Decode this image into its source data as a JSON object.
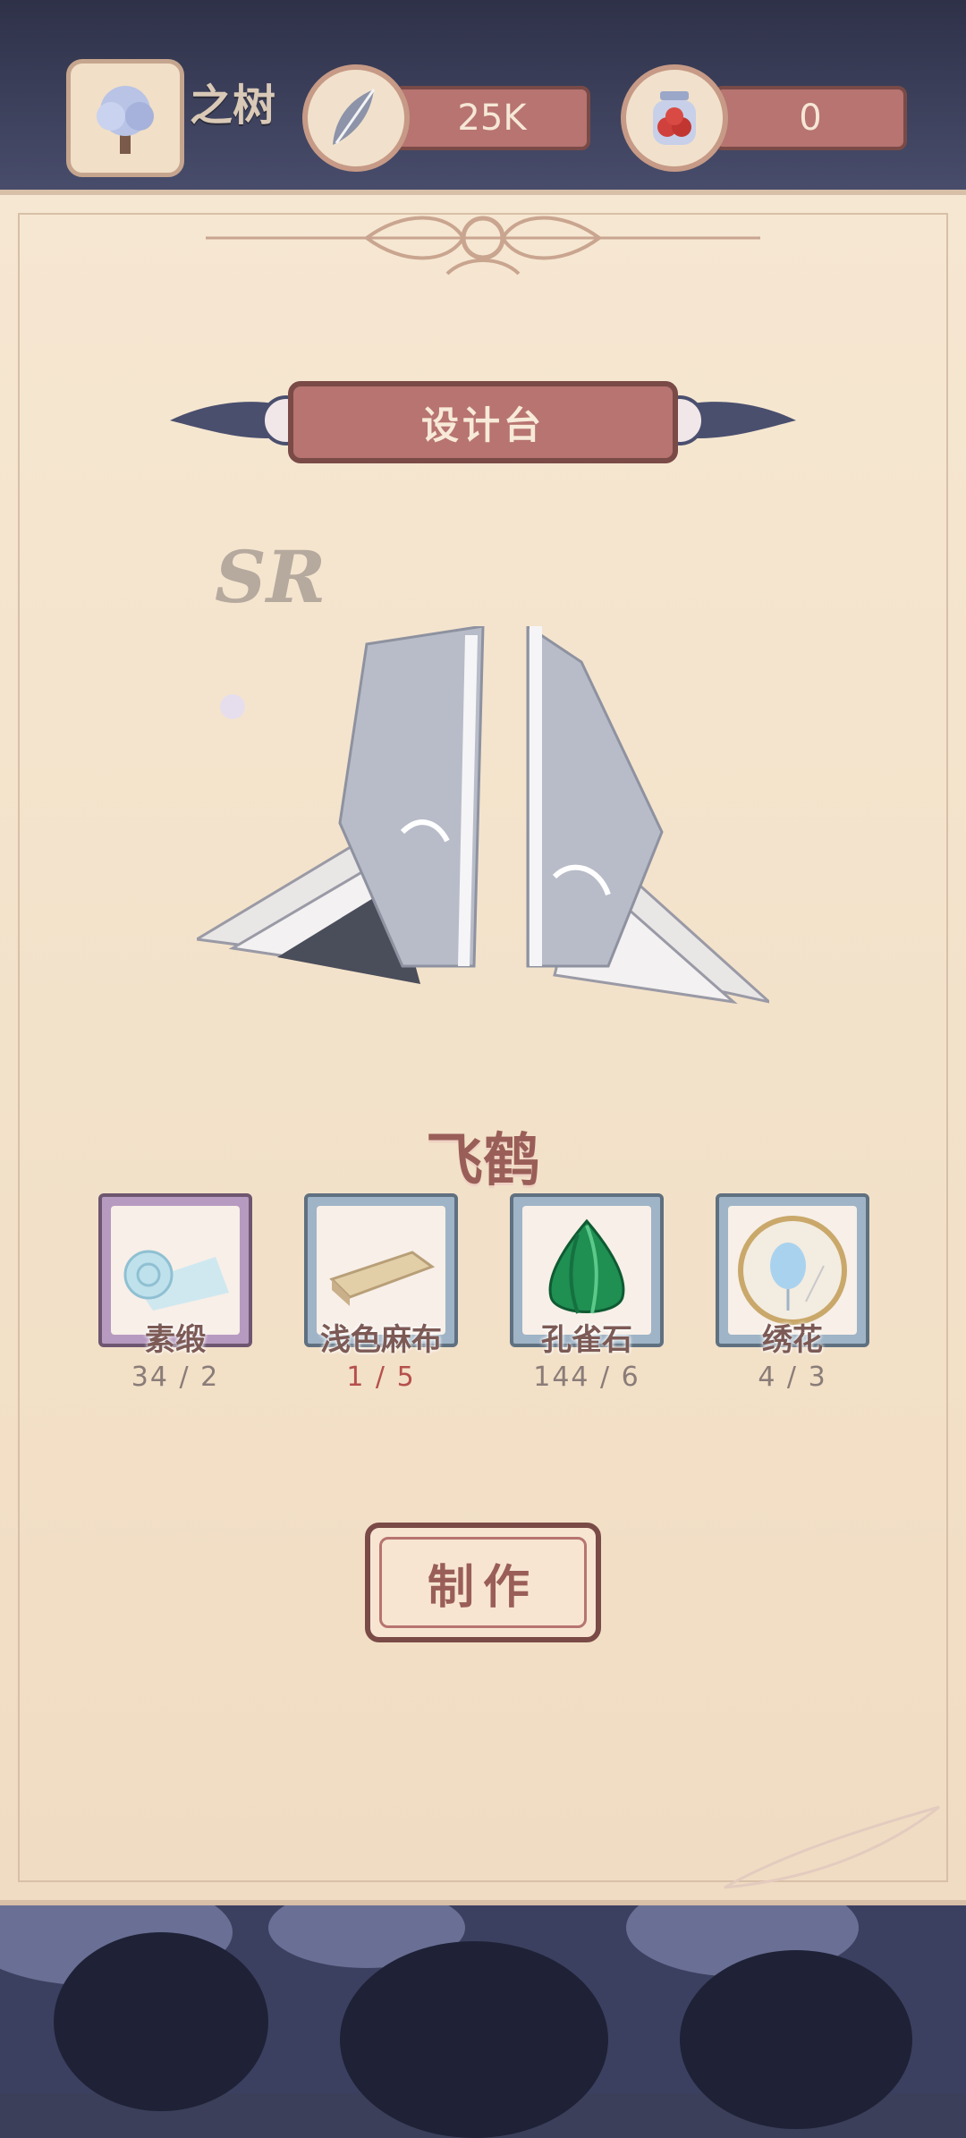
{
  "header": {
    "tree_label": "之树",
    "feather_amount": "25K",
    "berry_amount": "0"
  },
  "panel": {
    "title": "设计台",
    "rarity": "SR",
    "item_name": "飞鹤",
    "craft_label": "制作"
  },
  "materials": [
    {
      "name": "素缎",
      "count": "34 / 2",
      "frame_color": "#b79ac0",
      "count_color": "#8a7c78"
    },
    {
      "name": "浅色麻布",
      "count": "1 / 5",
      "frame_color": "#9fb4c6",
      "count_color": "#b5504b"
    },
    {
      "name": "孔雀石",
      "count": "144 / 6",
      "frame_color": "#9fb4c6",
      "count_color": "#8a7c78"
    },
    {
      "name": "绣花",
      "count": "4 / 3",
      "frame_color": "#9fb4c6",
      "count_color": "#8a7c78"
    }
  ],
  "colors": {
    "accent": "#b77470",
    "accent_dark": "#7a4a47",
    "parchment": "#f3e2ca"
  }
}
